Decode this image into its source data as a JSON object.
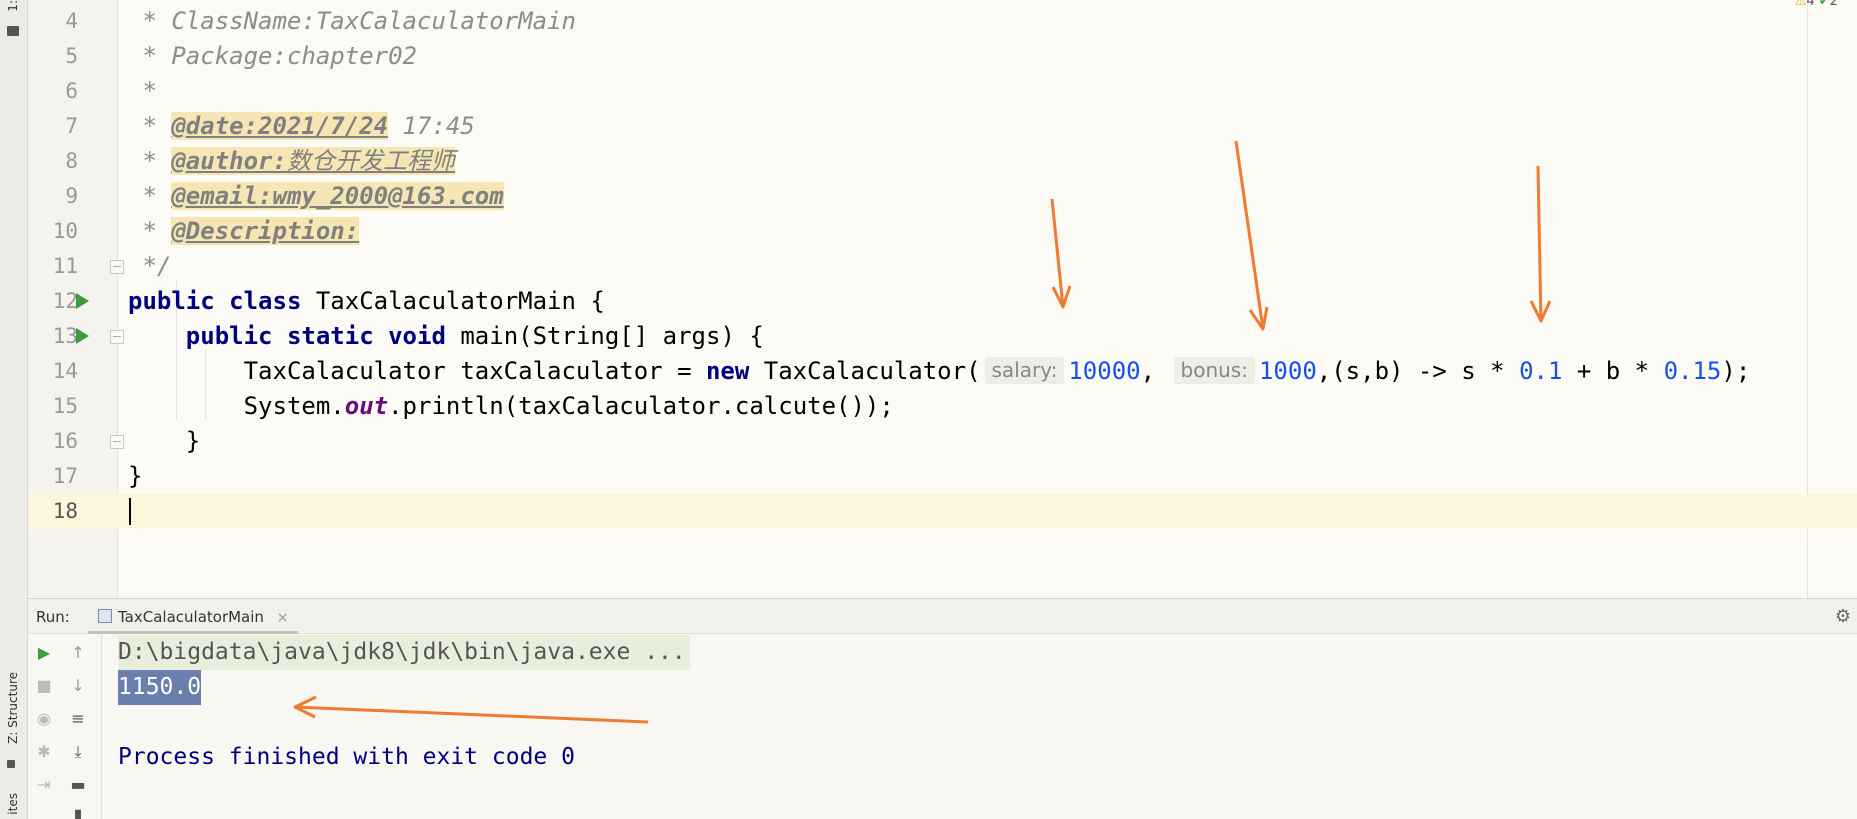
{
  "colors": {
    "keyword": "#000080",
    "number": "#1750eb",
    "comment": "#8c8c8c",
    "doc_tag_bg": "#f5e6b3",
    "run_marker": "#3e9b3e",
    "annotation_arrow": "#f07a30",
    "selection": "#6a7fae"
  },
  "left_strip": {
    "project_tab": "1:",
    "structure_tab": "Z: Structure",
    "favorites_tab": "ites"
  },
  "editor": {
    "indicators": {
      "warnings": "4",
      "ok": "2",
      "up": "^"
    },
    "lines": {
      "l4": {
        "num": "4",
        "prefix": " * ",
        "text": "ClassName:TaxCalaculatorMain"
      },
      "l5": {
        "num": "5",
        "prefix": " * ",
        "text": "Package:chapter02"
      },
      "l6": {
        "num": "6",
        "prefix": " *",
        "text": ""
      },
      "l7": {
        "num": "7",
        "prefix": " * ",
        "tag": "@date:2021/7/24",
        "rest": " 17:45"
      },
      "l8": {
        "num": "8",
        "prefix": " * ",
        "tag": "@author:",
        "tagval": "数仓开发工程师"
      },
      "l9": {
        "num": "9",
        "prefix": " * ",
        "tag": "@email:wmy_2000@163.com"
      },
      "l10": {
        "num": "10",
        "prefix": " * ",
        "tag": "@Description:"
      },
      "l11": {
        "num": "11",
        "text": " */"
      },
      "l12": {
        "num": "12",
        "kw1": "public",
        "kw2": "class",
        "rest": " TaxCalaculatorMain {"
      },
      "l13": {
        "num": "13",
        "indent": "    ",
        "kw1": "public",
        "kw2": "static",
        "kw3": "void",
        "rest": " main(String[] args) {"
      },
      "l14": {
        "num": "14",
        "part1": "        TaxCalaculator taxCalaculator = ",
        "kw": "new",
        "part2": " TaxCalaculator(",
        "hint1": "salary:",
        "val1": "10000",
        "sep1": ", ",
        "hint2": "bonus:",
        "val2": "1000",
        "part3": ",(s,b) -> s * ",
        "val3": "0.1",
        "part4": " + b * ",
        "val4": "0.15",
        "part5": ");"
      },
      "l15": {
        "num": "15",
        "part1": "        System.",
        "static": "out",
        "part2": ".println(taxCalaculator.calcute());"
      },
      "l16": {
        "num": "16",
        "text": "    }"
      },
      "l17": {
        "num": "17",
        "text": "}"
      },
      "l18": {
        "num": "18",
        "text": ""
      }
    }
  },
  "run_panel": {
    "label": "Run:",
    "tab": "TaxCalaculatorMain",
    "close": "×",
    "settings_icon": "⚙",
    "toolbar": {
      "rerun": "▶",
      "up": "↑",
      "stop": "■",
      "down": "↓",
      "snapshot": "◉",
      "wrap": "≡",
      "debug": "✱",
      "scroll_end": "⤓",
      "exit": "⇥",
      "print": "▬",
      "trash": "▮"
    },
    "console": {
      "command": "D:\\bigdata\\java\\jdk8\\jdk\\bin\\java.exe ...",
      "result": "1150.0",
      "exit_message": "Process finished with exit code 0"
    }
  }
}
